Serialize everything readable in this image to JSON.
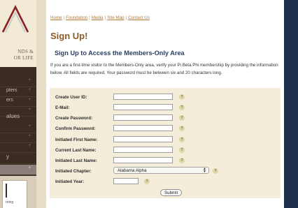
{
  "sidebar": {
    "tagline_line1": "NDS &",
    "tagline_line2": "OR LIFE",
    "items": [
      {
        "label": "",
        "arrow": "+"
      },
      {
        "label": "pters",
        "arrow": "+"
      },
      {
        "label": "ers",
        "arrow": "+"
      },
      {
        "label": "",
        "arrow": "+"
      },
      {
        "label": "alues",
        "arrow": ""
      },
      {
        "label": "",
        "arrow": "+"
      },
      {
        "label": "",
        "arrow": "+"
      },
      {
        "label": "",
        "arrow": "+"
      },
      {
        "label": "y",
        "arrow": ""
      },
      {
        "label": "",
        "arrow": "+"
      }
    ],
    "card_text": "rning"
  },
  "breadcrumb": {
    "home": "Home",
    "foundation": "Foundation",
    "media": "Media",
    "site_map": "Site Map",
    "contact": "Contact Us",
    "sep": "|"
  },
  "page_title": "Sign Up!",
  "subtitle": "Sign Up to Access the Members-Only Area",
  "intro_text": "If you are a first-time visitor to the Members-Only area, verify your Pi Beta Phi membership by providing the information below. All fields are required. Your password must be between six and 20 characters long.",
  "form": {
    "user_id": {
      "label": "Create User ID:",
      "value": ""
    },
    "email": {
      "label": "E-Mail:",
      "value": ""
    },
    "password": {
      "label": "Create Password:",
      "value": ""
    },
    "confirm_password": {
      "label": "Confirm Password:",
      "value": ""
    },
    "first_name": {
      "label": "Initiated First Name:",
      "value": ""
    },
    "current_last_name": {
      "label": "Current Last Name:",
      "value": ""
    },
    "initiated_last_name": {
      "label": "Initiated Last Name:",
      "value": ""
    },
    "chapter": {
      "label": "Initiated Chapter:",
      "selected": "Alabama Alpha"
    },
    "year": {
      "label": "Initiated Year:",
      "value": ""
    },
    "help_glyph": "?",
    "submit_label": "Submit"
  },
  "colors": {
    "title": "#8c5a29",
    "subtitle": "#2c3f63",
    "link": "#b37a3a",
    "form_bg": "#f3edd9",
    "sidebar_bg": "#3a2c22",
    "right_bar": "#1d2f4a"
  }
}
